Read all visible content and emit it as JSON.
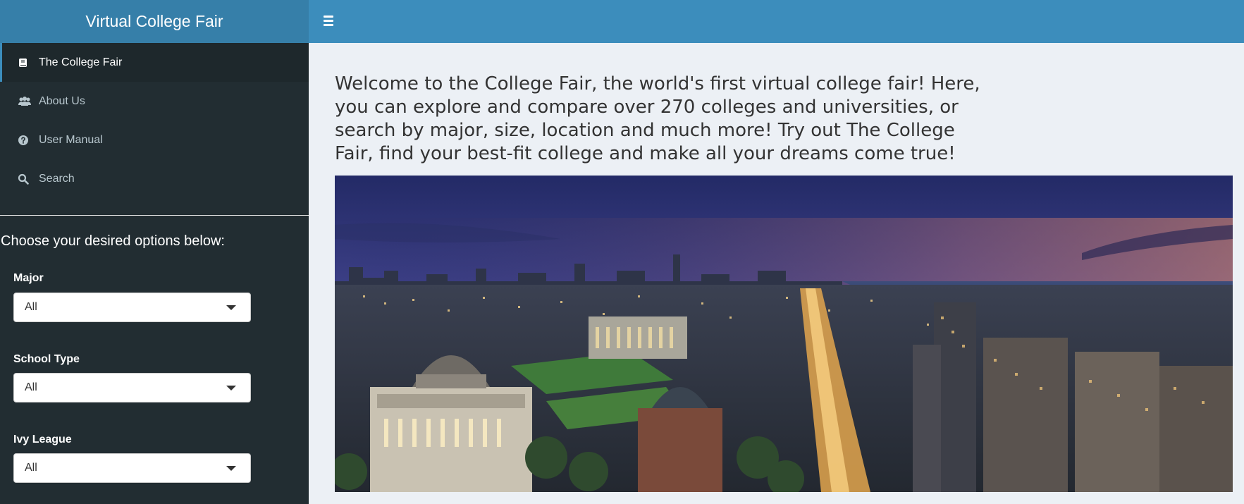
{
  "app": {
    "title": "Virtual College Fair"
  },
  "header": {
    "toggle_icon": "bars-icon"
  },
  "sidebar": {
    "menu": [
      {
        "label": "The College Fair",
        "icon": "book-icon",
        "active": true
      },
      {
        "label": "About Us",
        "icon": "users-icon",
        "active": false
      },
      {
        "label": "User Manual",
        "icon": "question-circle-icon",
        "active": false
      },
      {
        "label": "Search",
        "icon": "search-icon",
        "active": false
      }
    ],
    "options_heading": "Choose your desired options below:",
    "filters": [
      {
        "label": "Major",
        "value": "All"
      },
      {
        "label": "School Type",
        "value": "All"
      },
      {
        "label": "Ivy League",
        "value": "All"
      }
    ]
  },
  "main": {
    "welcome_text": "Welcome to the College Fair, the world's first virtual college fair! Here, you can explore and compare over 270 colleges and universities, or search by major, size, location and much more! Try out The College Fair, find your best-fit college and make all your dreams come true!",
    "image_alt": "Aerial night view of a college campus in a city along a river"
  },
  "colors": {
    "header": "#3c8dbc",
    "logo": "#367fa9",
    "sidebar": "#222d32",
    "sidebar_active": "#1e282c",
    "content_bg": "#ecf0f5"
  }
}
